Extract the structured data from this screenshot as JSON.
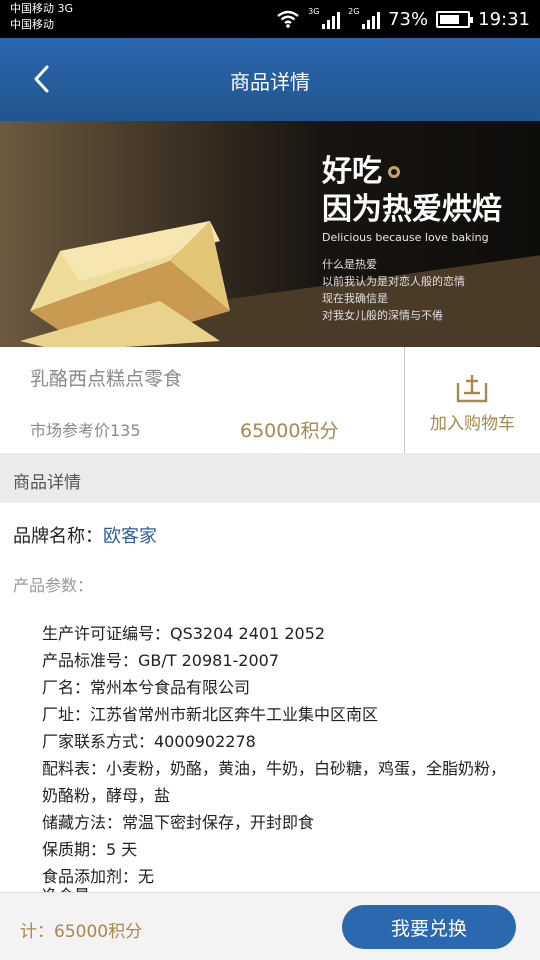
{
  "status_bar": {
    "carrier_1": "中国移动 3G",
    "carrier_2": "中国移动",
    "net_1": "3G",
    "net_2": "2G",
    "battery": "73%",
    "battery_level": 0.73,
    "time": "19:31",
    "icons": [
      "wifi-icon",
      "signal-icon",
      "signal-icon",
      "battery-icon"
    ]
  },
  "nav": {
    "title": "商品详情",
    "back_icon": "back-arrow-icon"
  },
  "banner": {
    "headline_1": "好吃",
    "headline_2": "因为热爱烘焙",
    "subline": "Delicious because love baking",
    "lines": [
      "什么是热爱",
      "以前我认为是对恋人般的恋情",
      "现在我确信是",
      "对我女儿般的深情与不倦"
    ],
    "pager": {
      "count": 2,
      "active": 0
    }
  },
  "product": {
    "name": "乳酪西点糕点零食",
    "market_price": "市场参考价135",
    "points": "65000积分",
    "cart_label": "加入购物车",
    "cart_icon": "cart-icon"
  },
  "details": {
    "section_title": "商品详情",
    "brand_label": "品牌名称：",
    "brand_value": "欧客家",
    "params_title": "产品参数：",
    "params": [
      "生产许可证编号：QS3204 2401 2052",
      "产品标准号：GB/T 20981-2007",
      "厂名：常州本兮食品有限公司",
      "厂址：江苏省常州市新北区奔牛工业集中区南区",
      "厂家联系方式：4000902278",
      "配料表：小麦粉，奶酪，黄油，牛奶，白砂糖，鸡蛋，全脂奶粉，奶酪粉，酵母，盐",
      "储藏方法：常温下密封保存，开封即食",
      "保质期：5 天",
      "食品添加剂：无"
    ],
    "cutoff_line": "净含量"
  },
  "footer": {
    "total": "计：65000积分",
    "redeem_label": "我要兑换"
  },
  "colors": {
    "nav_blue": "#2a69b0",
    "gold": "#a8884e",
    "brand_link": "#2b5f9e"
  }
}
